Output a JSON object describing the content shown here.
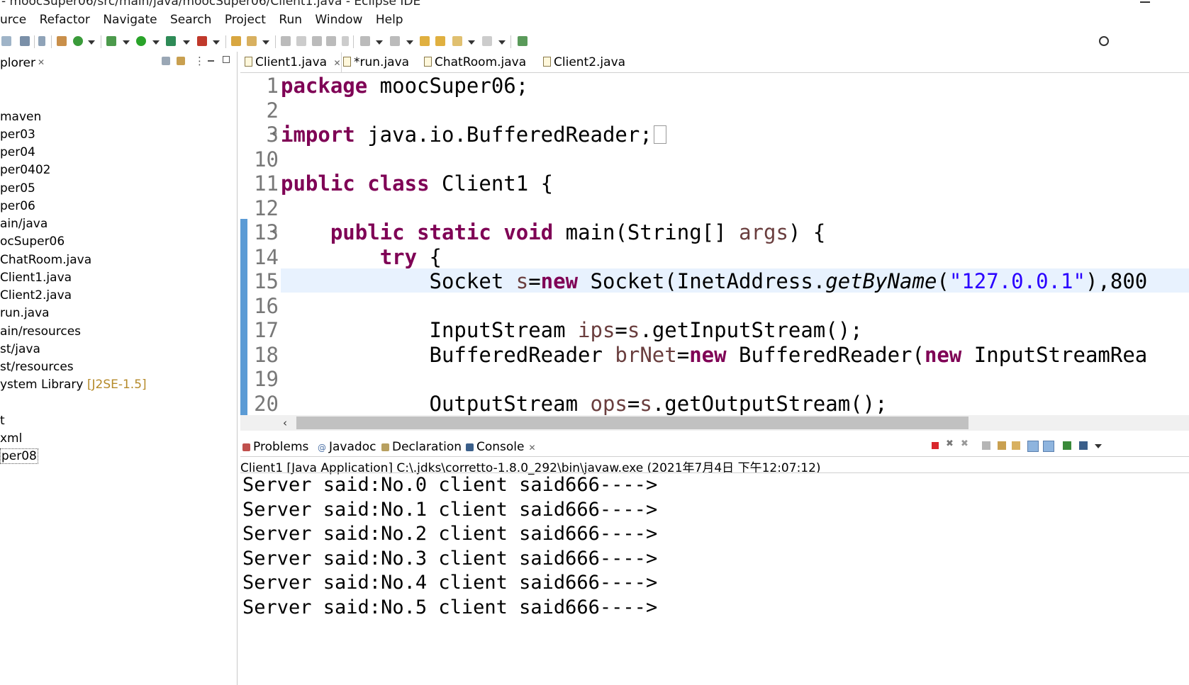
{
  "window": {
    "title": "- moocSuper06/src/main/java/moocSuper06/Client1.java - Eclipse IDE"
  },
  "menu": [
    "urce",
    "Refactor",
    "Navigate",
    "Search",
    "Project",
    "Run",
    "Window",
    "Help"
  ],
  "explorer": {
    "tab_label": "plorer",
    "close_glyph": "✕",
    "items": [
      {
        "label": "maven"
      },
      {
        "label": "per03"
      },
      {
        "label": "per04"
      },
      {
        "label": "per0402"
      },
      {
        "label": "per05"
      },
      {
        "label": "per06"
      },
      {
        "label": "ain/java"
      },
      {
        "label": "ocSuper06"
      },
      {
        "label": "ChatRoom.java"
      },
      {
        "label": "Client1.java"
      },
      {
        "label": "Client2.java"
      },
      {
        "label": "run.java"
      },
      {
        "label": "ain/resources"
      },
      {
        "label": "st/java"
      },
      {
        "label": "st/resources"
      },
      {
        "label": "ystem Library",
        "decoration": "[J2SE-1.5]"
      },
      {
        "label": ""
      },
      {
        "label": "t"
      },
      {
        "label": "xml"
      },
      {
        "label": "per08"
      }
    ]
  },
  "editor": {
    "tabs": [
      {
        "label": "Client1.java",
        "close": "✕"
      },
      {
        "label": "*run.java"
      },
      {
        "label": "ChatRoom.java"
      },
      {
        "label": "Client2.java"
      }
    ],
    "lines": {
      "l1": {
        "num": "1",
        "kw": "package",
        "rest": " moocSuper06;"
      },
      "l2": {
        "num": "2"
      },
      "l3": {
        "num": "3",
        "kw": "import",
        "rest": " java.io.BufferedReader;"
      },
      "l10": {
        "num": "10"
      },
      "l11": {
        "num": "11",
        "kw1": "public",
        "kw2": "class",
        "rest": " Client1 {"
      },
      "l12": {
        "num": "12"
      },
      "l13": {
        "num": "13",
        "kw1": "public",
        "kw2": "static",
        "kw3": "void",
        "a": " main(String[] ",
        "var": "args",
        "b": ") {"
      },
      "l14": {
        "num": "14",
        "kw": "try",
        "rest": " {"
      },
      "l15": {
        "num": "15",
        "a": "Socket ",
        "var": "s",
        "b": "=",
        "kw": "new",
        "c": " Socket(InetAddress.",
        "method": "getByName",
        "d": "(",
        "str": "\"127.0.0.1\"",
        "e": "),800"
      },
      "l16": {
        "num": "16"
      },
      "l17": {
        "num": "17",
        "a": "InputStream ",
        "var": "ips",
        "b": "=",
        "var2": "s",
        "c": ".getInputStream();"
      },
      "l18": {
        "num": "18",
        "a": "BufferedReader ",
        "var": "brNet",
        "b": "=",
        "kw": "new",
        "c": " BufferedReader(",
        "kw2": "new",
        "d": " InputStreamRea"
      },
      "l19": {
        "num": "19"
      },
      "l20": {
        "num": "20",
        "a": "OutputStream ",
        "var": "ops",
        "b": "=",
        "var2": "s",
        "c": ".getOutputStream();"
      }
    }
  },
  "console": {
    "tabs": [
      {
        "label": "Problems"
      },
      {
        "label": "Javadoc"
      },
      {
        "label": "Declaration"
      },
      {
        "label": "Console",
        "close": "✕"
      }
    ],
    "description": "Client1 [Java Application] C:\\.jdks\\corretto-1.8.0_292\\bin\\javaw.exe  (2021年7月4日 下午12:07:12)",
    "output": [
      "Server said:No.0 client said666---->",
      "Server said:No.1 client said666---->",
      "Server said:No.2 client said666---->",
      "Server said:No.3 client said666---->",
      "Server said:No.4 client said666---->",
      "Server said:No.5 client said666---->"
    ]
  },
  "colors": {
    "keyword": "#7f0055",
    "string": "#2a00ff",
    "local_variable": "#6a3e3e",
    "current_line": "#e8f2fe",
    "change_bar": "#5b9bd5"
  },
  "icons": {
    "search": "search-icon",
    "terminate": "stop-icon"
  }
}
